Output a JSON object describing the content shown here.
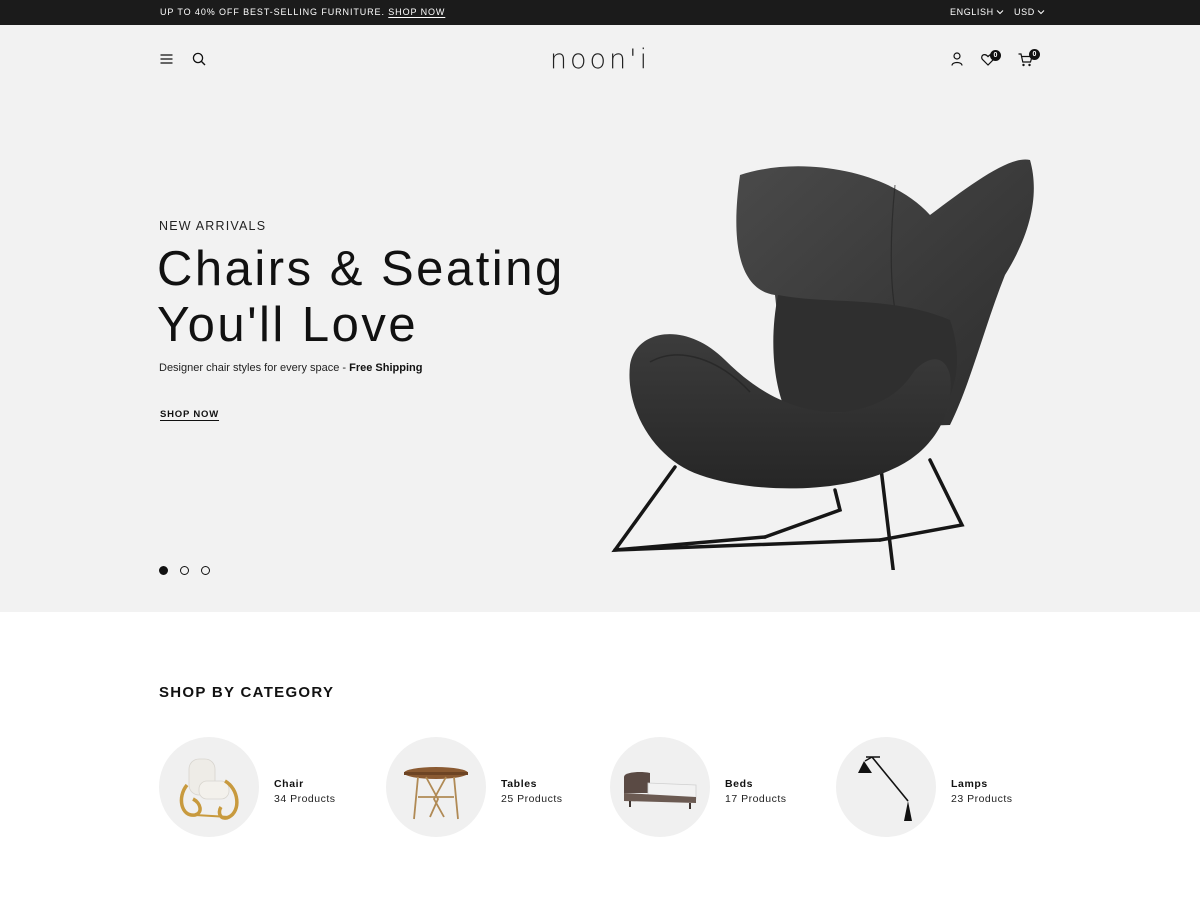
{
  "topbar": {
    "promo_text": "UP TO 40% OFF BEST-SELLING FURNITURE.",
    "promo_link": "SHOP NOW",
    "language": "ENGLISH",
    "currency": "USD"
  },
  "header": {
    "logo": "noon'i",
    "wishlist_count": "0",
    "cart_count": "0"
  },
  "hero": {
    "eyebrow": "NEW ARRIVALS",
    "headline_line1": "Chairs & Seating",
    "headline_line2": "You'll Love",
    "subtitle": "Designer chair styles for every space - ",
    "subtitle_bold": "Free Shipping",
    "cta": "SHOP NOW",
    "slides": 3,
    "active_slide": 1
  },
  "categories": {
    "title": "SHOP BY CATEGORY",
    "items": [
      {
        "name": "Chair",
        "count": "34 Products"
      },
      {
        "name": "Tables",
        "count": "25 Products"
      },
      {
        "name": "Beds",
        "count": "17 Products"
      },
      {
        "name": "Lamps",
        "count": "23 Products"
      }
    ]
  },
  "colors": {
    "topbar_bg": "#1b1b1b",
    "hero_bg": "#f2f2f2",
    "text": "#111111",
    "circle_bg": "#f0f0f0"
  }
}
